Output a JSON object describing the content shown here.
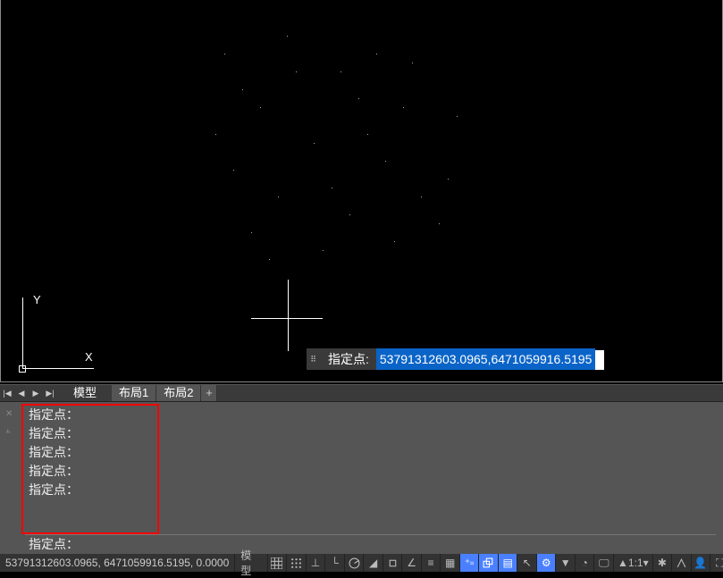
{
  "ucs": {
    "x_label": "X",
    "y_label": "Y"
  },
  "prompt": {
    "label": "指定点:",
    "value": "53791312603.0965,6471059916.5195"
  },
  "layout_nav": [
    "|◀",
    "◀",
    "▶",
    "▶|"
  ],
  "layout_tabs": [
    {
      "label": "模型",
      "active": true
    },
    {
      "label": "布局1",
      "active": false
    },
    {
      "label": "布局2",
      "active": false
    }
  ],
  "plus_tab": "+",
  "command_history": [
    "指定点：",
    "指定点：",
    "指定点：",
    "指定点：",
    "指定点："
  ],
  "command_current": "指定点：",
  "status": {
    "coords": "53791312603.0965, 6471059916.5195, 0.0000",
    "scale_label": "1:1",
    "icons": {
      "model": "模型",
      "grid": "grid-icon",
      "snap": "snap-icon",
      "ortho": "ortho-icon",
      "polar": "polar-icon",
      "osnap": "osnap-icon",
      "otrack": "otrack-icon",
      "dyn": "dyn-icon",
      "lwt": "lwt-icon"
    }
  }
}
